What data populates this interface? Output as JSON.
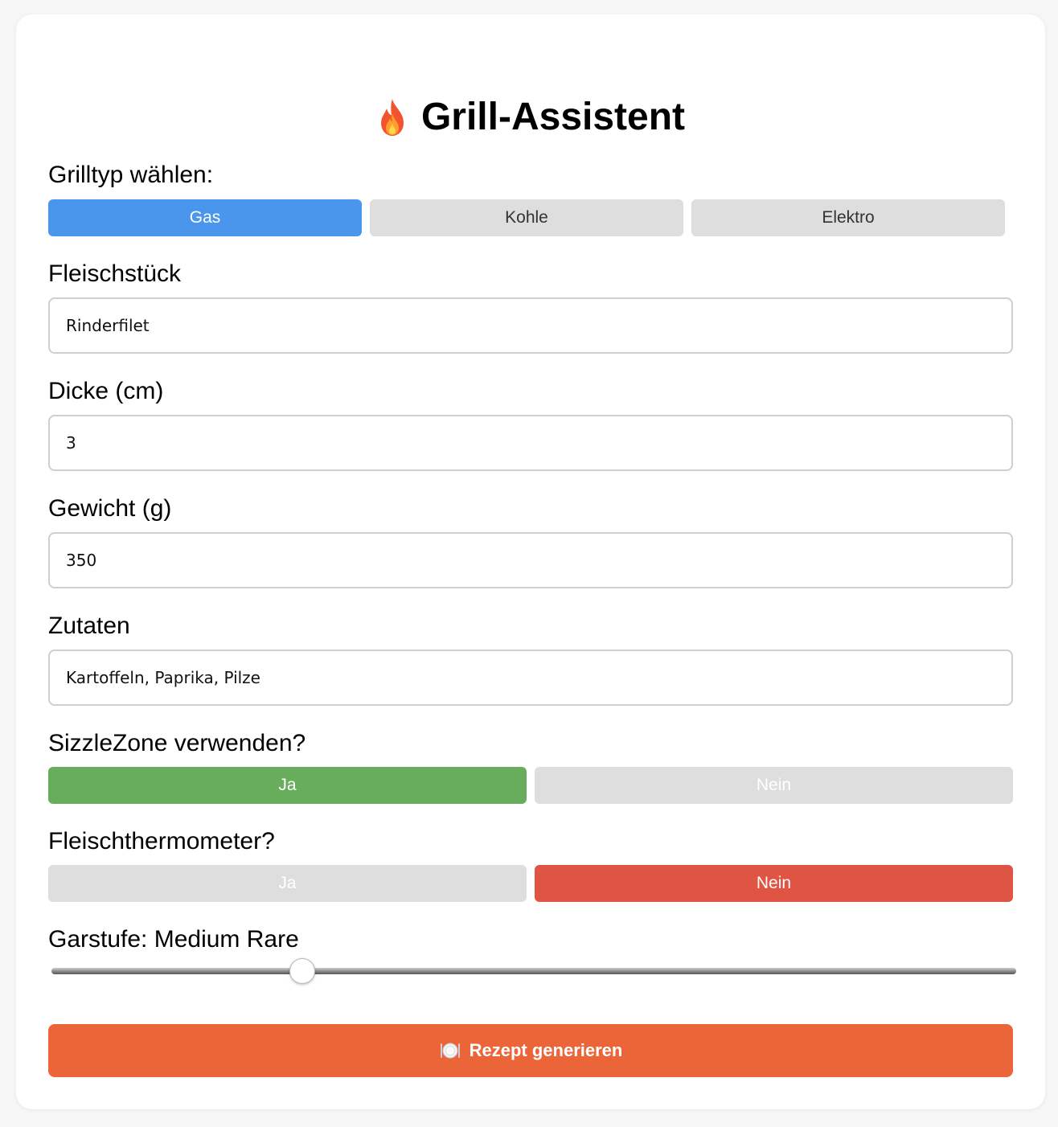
{
  "title": "Grill-Assistent",
  "grill": {
    "label": "Grilltyp wählen:",
    "options": [
      "Gas",
      "Kohle",
      "Elektro"
    ],
    "selected": "Gas",
    "active_color": "#4a96ec"
  },
  "meat": {
    "label": "Fleischstück",
    "value": "Rinderfilet"
  },
  "thickness": {
    "label": "Dicke (cm)",
    "value": "3"
  },
  "weight": {
    "label": "Gewicht (g)",
    "value": "350"
  },
  "ingredients": {
    "label": "Zutaten",
    "value": "Kartoffeln, Paprika, Pilze"
  },
  "sizzlezone": {
    "label": "SizzleZone verwenden?",
    "yes": "Ja",
    "no": "Nein",
    "selected": "Ja",
    "active_color": "#68ad5c"
  },
  "thermometer": {
    "label": "Fleischthermometer?",
    "yes": "Ja",
    "no": "Nein",
    "selected": "Nein",
    "active_color": "#e05443"
  },
  "doneness": {
    "label": "Garstufe: Medium Rare",
    "level_fraction": 0.26
  },
  "submit": {
    "label": "Rezept generieren",
    "color": "#ec6539"
  }
}
